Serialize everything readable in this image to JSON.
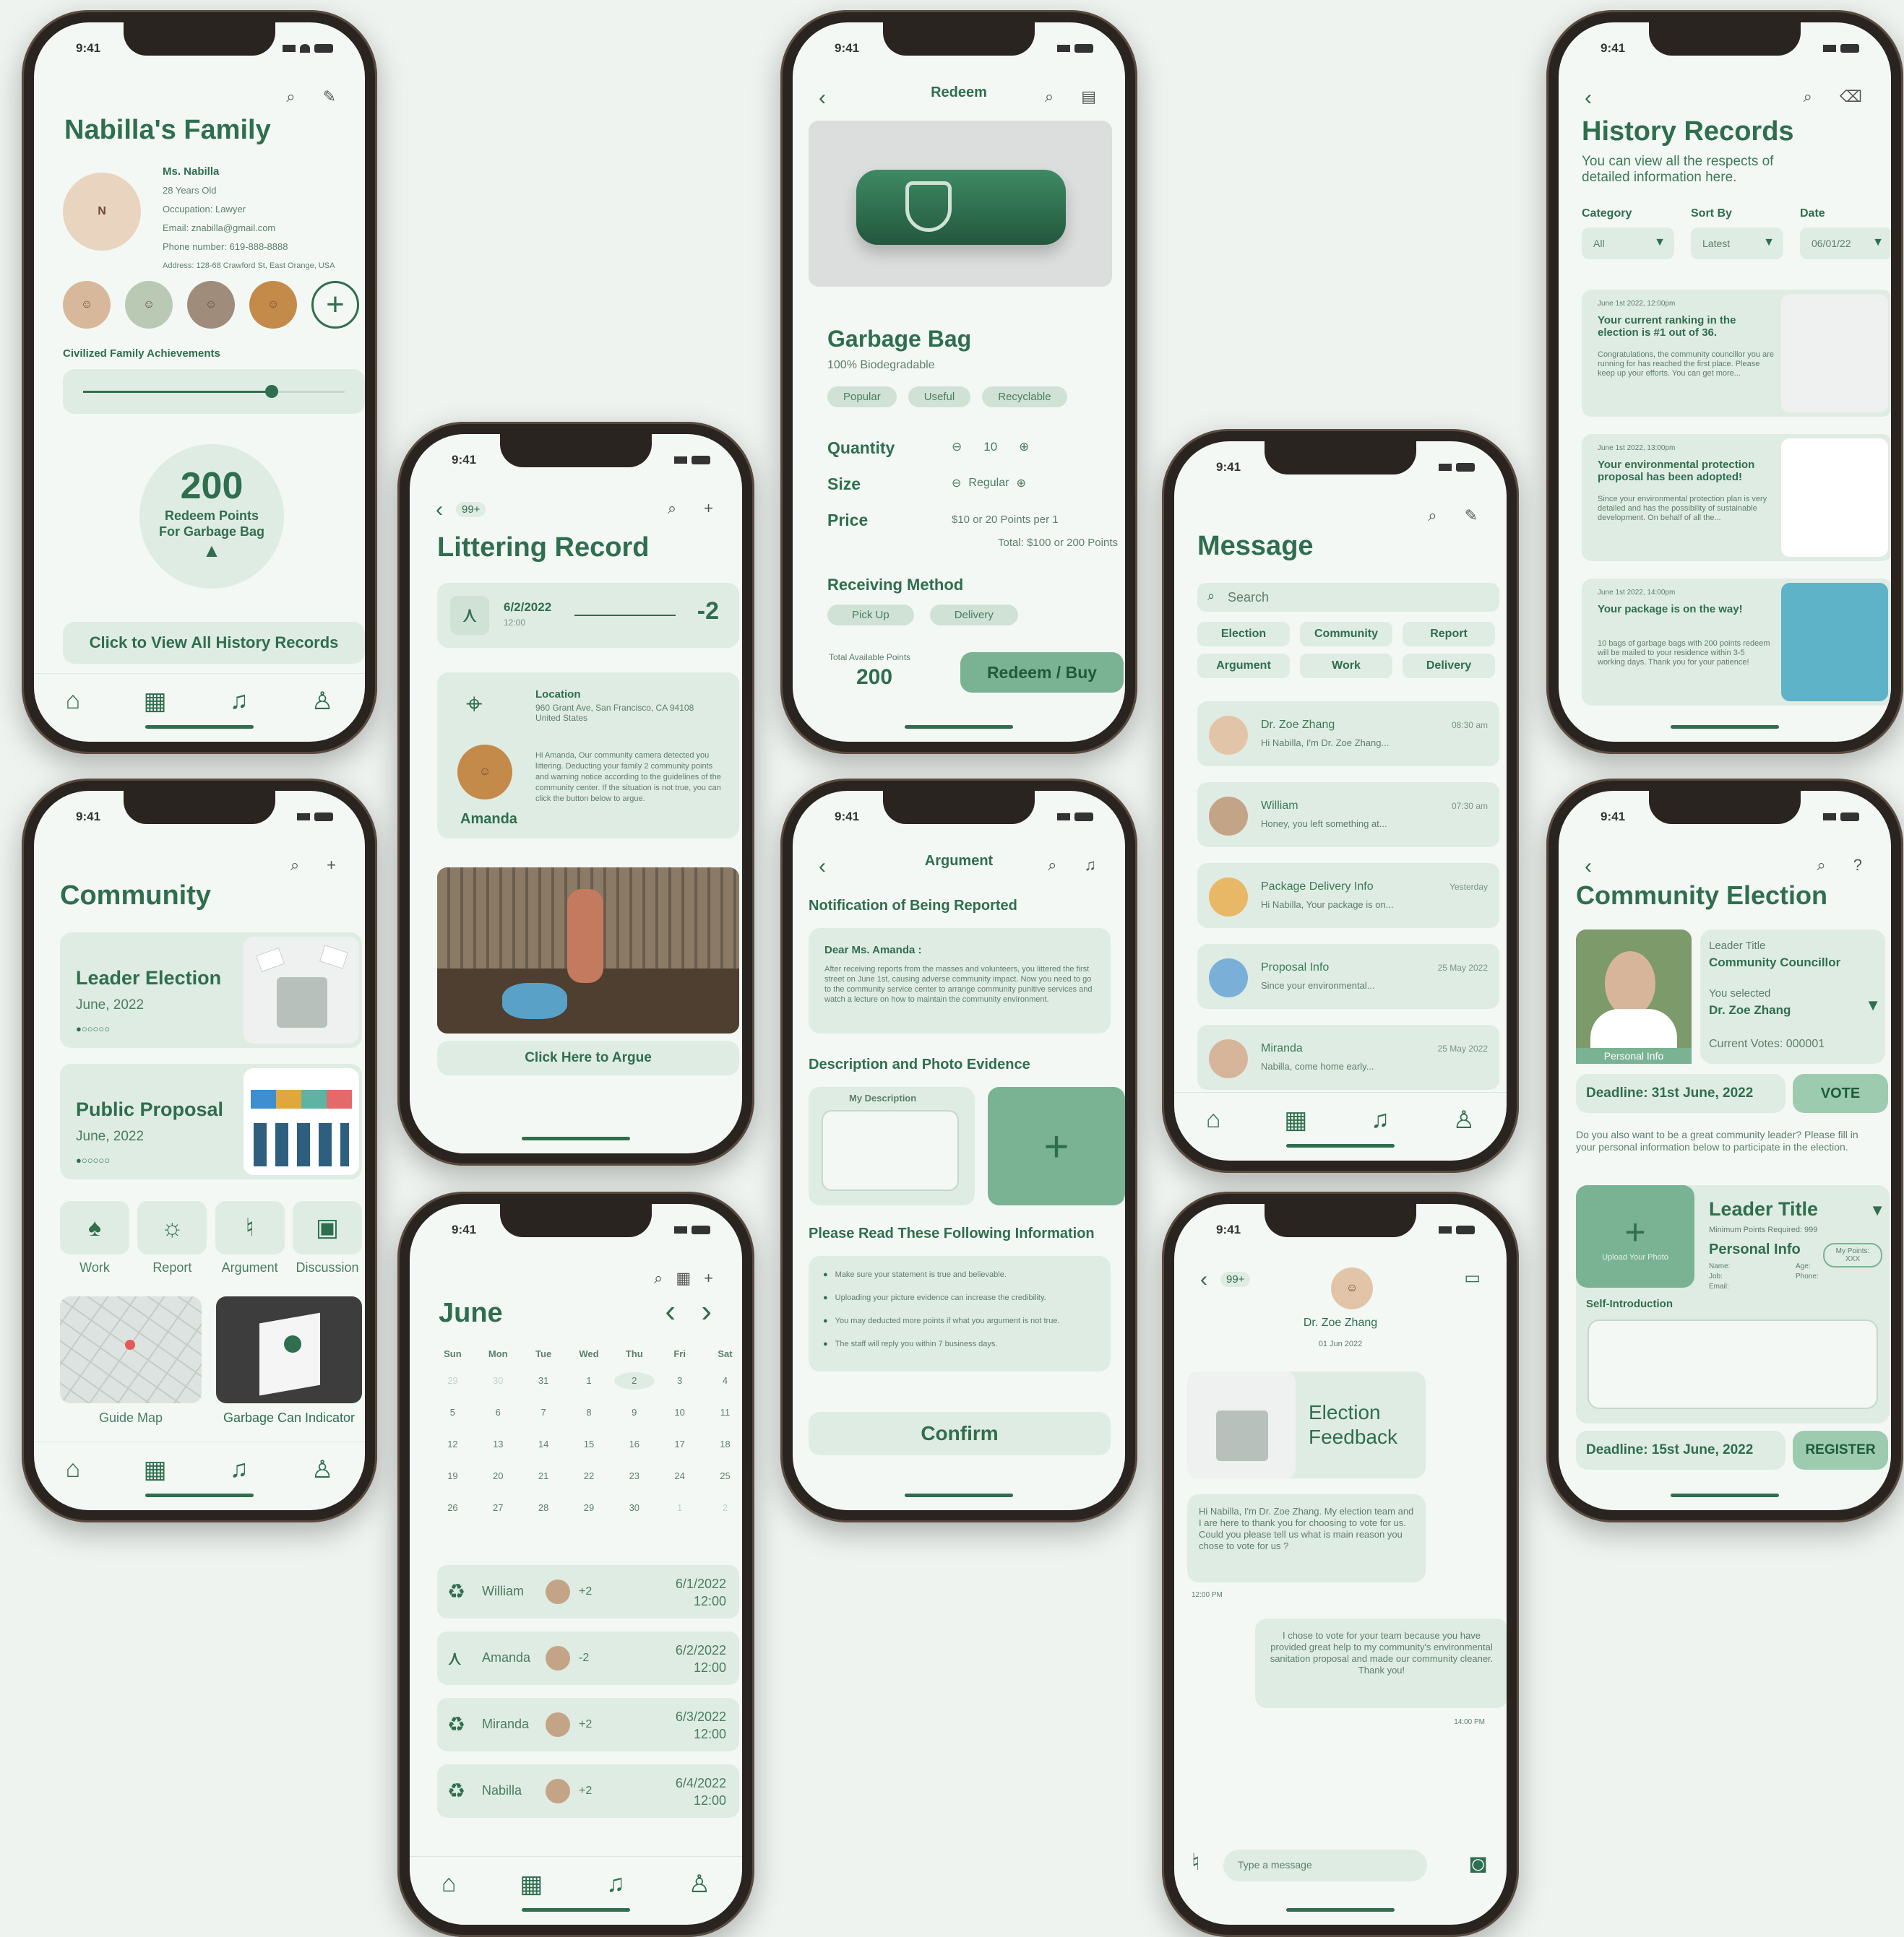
{
  "status": {
    "time": "9:41"
  },
  "family": {
    "title": "Nabilla's Family",
    "name": "Ms. Nabilla",
    "age": "28 Years Old",
    "occupation": "Occupation: Lawyer",
    "email": "Email: znabilla@gmail.com",
    "phone": "Phone number: 619-888-8888",
    "address": "Address: 128-68 Crawford St, East Orange, USA",
    "achievements": "Civilized Family Achievements",
    "progress": 0.72,
    "points": "200",
    "points_label": "Redeem Points For Garbage Bag",
    "history_button": "Click to View All History Records"
  },
  "community": {
    "title": "Community",
    "leader": "Leader Election",
    "leader_date": "June, 2022",
    "proposal": "Public Proposal",
    "proposal_date": "June, 2022",
    "icons": [
      {
        "label": "Work",
        "icon": "broom-icon"
      },
      {
        "label": "Report",
        "icon": "alarm-icon"
      },
      {
        "label": "Argument",
        "icon": "microphone-icon"
      },
      {
        "label": "Discussion",
        "icon": "chat-icon"
      }
    ],
    "guide": "Guide Map",
    "garbage": "Garbage Can Indicator"
  },
  "littering": {
    "badge": "99+",
    "title": "Littering Record",
    "date": "6/2/2022",
    "time": "12:00",
    "delta": "-2",
    "location_label": "Location",
    "location": "960 Grant Ave, San Francisco, CA 94108 United States",
    "message": "Hi Amanda, Our community camera detected you littering. Deducting your family 2 community points and warning notice according to the guidelines of the community center. If the situation is not true, you can click the button below to argue.",
    "person": "Amanda",
    "argue": "Click Here to Argue"
  },
  "calendar": {
    "month": "June",
    "days": [
      "Sun",
      "Mon",
      "Tue",
      "Wed",
      "Thu",
      "Fri",
      "Sat"
    ],
    "weeks": [
      [
        "29",
        "30",
        "31",
        "1",
        "2",
        "3",
        "4"
      ],
      [
        "5",
        "6",
        "7",
        "8",
        "9",
        "10",
        "11"
      ],
      [
        "12",
        "13",
        "14",
        "15",
        "16",
        "17",
        "18"
      ],
      [
        "19",
        "20",
        "21",
        "22",
        "23",
        "24",
        "25"
      ],
      [
        "26",
        "27",
        "28",
        "29",
        "30",
        "1",
        "2"
      ]
    ],
    "records": [
      {
        "name": "William",
        "delta": "+2",
        "date": "6/1/2022",
        "time": "12:00"
      },
      {
        "name": "Amanda",
        "delta": "-2",
        "date": "6/2/2022",
        "time": "12:00"
      },
      {
        "name": "Miranda",
        "delta": "+2",
        "date": "6/3/2022",
        "time": "12:00"
      },
      {
        "name": "Nabilla",
        "delta": "+2",
        "date": "6/4/2022",
        "time": "12:00"
      }
    ]
  },
  "redeem": {
    "header": "Redeem",
    "product": "Garbage Bag",
    "subtitle": "100% Biodegradable",
    "tags": [
      "Popular",
      "Useful",
      "Recyclable"
    ],
    "quantity_label": "Quantity",
    "quantity": "10",
    "size_label": "Size",
    "size": "Regular",
    "price_label": "Price",
    "price": "$10 or 20 Points per 1",
    "total": "Total: $100 or 200 Points",
    "receiving": "Receiving Method",
    "methods": [
      "Pick Up",
      "Delivery"
    ],
    "available_label": "Total Available Points",
    "available": "200",
    "buy": "Redeem / Buy"
  },
  "argument": {
    "header": "Argument",
    "notification": "Notification of Being Reported",
    "dear": "Dear Ms. Amanda :",
    "body": "After receiving reports from the masses and volunteers, you littered the first street on June 1st, causing adverse community impact. Now you need to go to the community service center to arrange community punitive services and watch a lecture on how to maintain the community environment.",
    "evidence": "Description and Photo Evidence",
    "my_desc": "My Description",
    "read": "Please Read These Following Information",
    "rules": [
      "Make sure your statement is true and believable.",
      "Uploading your picture evidence can increase the credibility.",
      "You may deducted more points if what you argument is not true.",
      "The staff will reply you within 7 business days."
    ],
    "confirm": "Confirm"
  },
  "message": {
    "title": "Message",
    "search": "Search",
    "filters": [
      "Election",
      "Community",
      "Report",
      "Argument",
      "Work",
      "Delivery"
    ],
    "items": [
      {
        "name": "Dr. Zoe Zhang",
        "preview": "Hi Nabilla, I'm Dr. Zoe Zhang...",
        "time": "08:30 am"
      },
      {
        "name": "William",
        "preview": "Honey, you left something at...",
        "time": "07:30 am"
      },
      {
        "name": "Package Delivery Info",
        "preview": "Hi Nabilla, Your package is on...",
        "time": "Yesterday"
      },
      {
        "name": "Proposal Info",
        "preview": "Since your environmental...",
        "time": "25 May 2022"
      },
      {
        "name": "Miranda",
        "preview": "Nabilla, come home early...",
        "time": "25 May 2022"
      }
    ]
  },
  "chat": {
    "badge": "99+",
    "name": "Dr. Zoe Zhang",
    "date": "01 Jun 2022",
    "card_title": "Election Feedback",
    "incoming": "Hi Nabilla, I'm Dr. Zoe Zhang. My election team and I are here to thank you for choosing to vote for us. Could you please tell us what is main reason you chose to vote for us ?",
    "in_time": "12:00 PM",
    "outgoing": "I chose to vote for your team because you have provided great help to my community's environmental sanitation proposal and made our community cleaner. Thank you!",
    "out_time": "14:00 PM",
    "input": "Type a message"
  },
  "history": {
    "title": "History Records",
    "subtitle": "You can view all the respects of detailed information here.",
    "filters": [
      {
        "label": "Category",
        "value": "All"
      },
      {
        "label": "Sort By",
        "value": "Latest"
      },
      {
        "label": "Date",
        "value": "06/01/22"
      }
    ],
    "items": [
      {
        "date": "June 1st 2022, 12:00pm",
        "title": "Your current ranking in the election is #1 out of 36.",
        "body": "Congratulations, the community councillor you are running for has reached the first place. Please keep up your efforts. You can get more..."
      },
      {
        "date": "June 1st 2022, 13:00pm",
        "title": "Your environmental protection proposal has been adopted!",
        "body": "Since your environmental protection plan is very detailed and has the possibility of sustainable development. On behalf of all the..."
      },
      {
        "date": "June 1st 2022, 14:00pm",
        "title": "Your package is on the way!",
        "body": "10 bags of garbage bags with 200 points redeem will be mailed to your residence within 3-5 working days. Thank you for your patience!"
      }
    ]
  },
  "election": {
    "title": "Community Election",
    "leader_label": "Leader Title",
    "leader_value": "Community Councillor",
    "selected_label": "You selected",
    "selected_value": "Dr. Zoe Zhang",
    "votes": "Current Votes: 000001",
    "personal": "Personal Info",
    "deadline": "Deadline: 31st June, 2022",
    "vote": "VOTE",
    "invite": "Do you also want to be a great community leader? Please fill in your personal information below to participate in the election.",
    "upload": "Upload Your Photo",
    "leader_title2": "Leader Title",
    "min_points": "Minimum Points Required: 999",
    "personal2": "Personal Info",
    "my_points": "My Points: XXX",
    "fields": [
      "Name:",
      "Age:",
      "Job:",
      "Phone:",
      "Email:"
    ],
    "self_intro": "Self-Introduction",
    "deadline2": "Deadline: 15st June, 2022",
    "register": "REGISTER"
  },
  "colors": {
    "brand": "#2f6e4e",
    "accent": "#7ab393",
    "card": "#dfece3"
  }
}
